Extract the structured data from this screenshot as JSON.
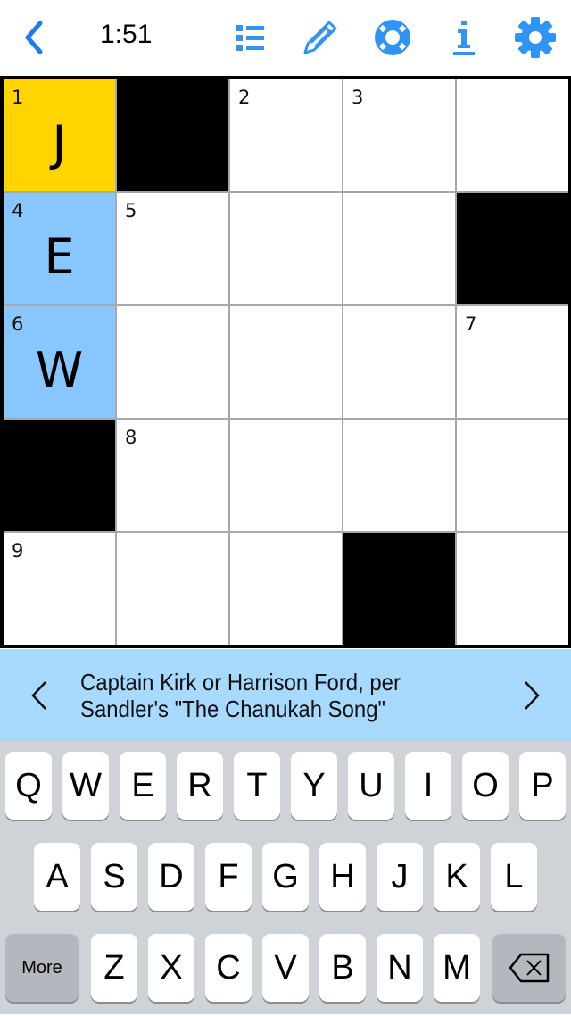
{
  "header": {
    "timer": "1:51",
    "accent_color": "#2e95f4",
    "icons": [
      "back-chevron-icon",
      "clue-list-icon",
      "pencil-icon",
      "help-lifebuoy-icon",
      "info-icon",
      "settings-gear-icon"
    ]
  },
  "grid": {
    "rows": 5,
    "cols": 5,
    "active_color": "#ffd500",
    "word_color": "#87c6ff",
    "cells": [
      [
        {
          "num": "1",
          "letter": "J",
          "state": "active"
        },
        {
          "black": true
        },
        {
          "num": "2",
          "letter": ""
        },
        {
          "num": "3",
          "letter": ""
        },
        {
          "letter": ""
        }
      ],
      [
        {
          "num": "4",
          "letter": "E",
          "state": "word"
        },
        {
          "num": "5",
          "letter": ""
        },
        {
          "letter": ""
        },
        {
          "letter": ""
        },
        {
          "black": true
        }
      ],
      [
        {
          "num": "6",
          "letter": "W",
          "state": "word"
        },
        {
          "letter": ""
        },
        {
          "letter": ""
        },
        {
          "letter": ""
        },
        {
          "num": "7",
          "letter": ""
        }
      ],
      [
        {
          "black": true
        },
        {
          "num": "8",
          "letter": ""
        },
        {
          "letter": ""
        },
        {
          "letter": ""
        },
        {
          "letter": ""
        }
      ],
      [
        {
          "num": "9",
          "letter": ""
        },
        {
          "letter": ""
        },
        {
          "letter": ""
        },
        {
          "black": true
        },
        {
          "letter": ""
        }
      ]
    ]
  },
  "clue": {
    "text": "Captain Kirk or Harrison Ford, per Sandler's \"The Chanukah Song\""
  },
  "keyboard": {
    "row1": [
      "Q",
      "W",
      "E",
      "R",
      "T",
      "Y",
      "U",
      "I",
      "O",
      "P"
    ],
    "row2": [
      "A",
      "S",
      "D",
      "F",
      "G",
      "H",
      "J",
      "K",
      "L"
    ],
    "row3": [
      "Z",
      "X",
      "C",
      "V",
      "B",
      "N",
      "M"
    ],
    "more_label": "More"
  }
}
